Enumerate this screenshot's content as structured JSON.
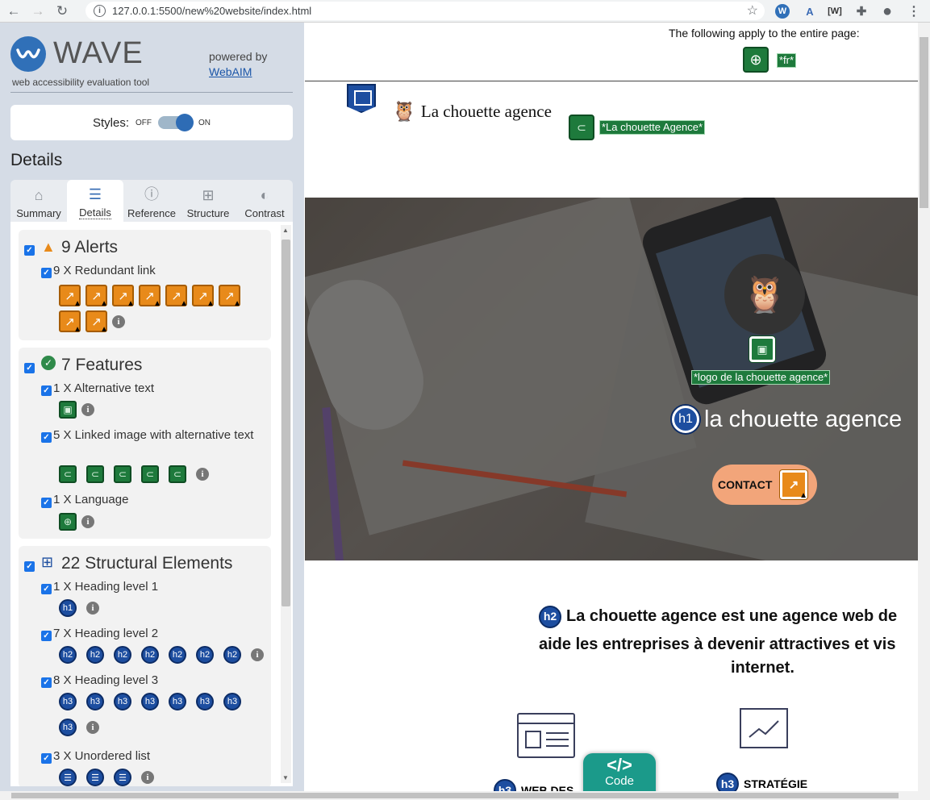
{
  "browser": {
    "url": "127.0.0.1:5500/new%20website/index.html",
    "ext_wave": "W",
    "ext_a11y": "A",
    "ext_w": "[W]"
  },
  "wave": {
    "title": "WAVE",
    "subtitle": "web accessibility evaluation tool",
    "powered_by": "powered by",
    "webaim": "WebAIM",
    "styles_label": "Styles:",
    "styles_off": "OFF",
    "styles_on": "ON",
    "details_heading": "Details",
    "tabs": [
      {
        "label": "Summary",
        "icon": "home-icon"
      },
      {
        "label": "Details",
        "icon": "list-icon"
      },
      {
        "label": "Reference",
        "icon": "info-icon"
      },
      {
        "label": "Structure",
        "icon": "structure-icon"
      },
      {
        "label": "Contrast",
        "icon": "contrast-icon"
      }
    ],
    "alerts": {
      "title": "9 Alerts",
      "items": [
        {
          "label": "9 X Redundant link",
          "count": 9
        }
      ]
    },
    "features": {
      "title": "7 Features",
      "items": [
        {
          "label": "1 X Alternative text",
          "count": 1
        },
        {
          "label": "5 X Linked image with alternative text",
          "count": 5
        },
        {
          "label": "1 X Language",
          "count": 1
        }
      ]
    },
    "structure": {
      "title": "22 Structural Elements",
      "items": [
        {
          "label": "1 X Heading level 1",
          "badge": "h1",
          "count": 1
        },
        {
          "label": "7 X Heading level 2",
          "badge": "h2",
          "count": 7
        },
        {
          "label": "8 X Heading level 3",
          "badge": "h3",
          "count": 8
        },
        {
          "label": "3 X Unordered list",
          "badge": "ul",
          "count": 3
        }
      ]
    }
  },
  "page": {
    "apply_text": "The following apply to the entire page:",
    "lang_label": "*fr*",
    "brand_name": "La chouette agence",
    "brand_alt": "*La chouette Agence*",
    "logo_alt": "*logo de la chouette agence*",
    "hero_h1_badge": "h1",
    "hero_title": "la chouette agence",
    "contact": "CONTACT",
    "intro_badge": "h2",
    "intro_line1": "La chouette agence est une agence web de",
    "intro_line2": "aide les entreprises à devenir attractives et vis",
    "intro_line3": "internet.",
    "svc1_badge": "h3",
    "svc1_label": "WEB DES",
    "svc2_badge": "h3",
    "svc2_label": "STRATÉGIE",
    "code_tab": "Code",
    "code_symbol": "</>"
  },
  "colors": {
    "wave_blue": "#3070b8",
    "alert_orange": "#e88a1a",
    "feature_green": "#1e7a3c",
    "structure_blue": "#1d4ea0",
    "contact_peach": "#f2a57a",
    "code_teal": "#1b9a8a"
  }
}
